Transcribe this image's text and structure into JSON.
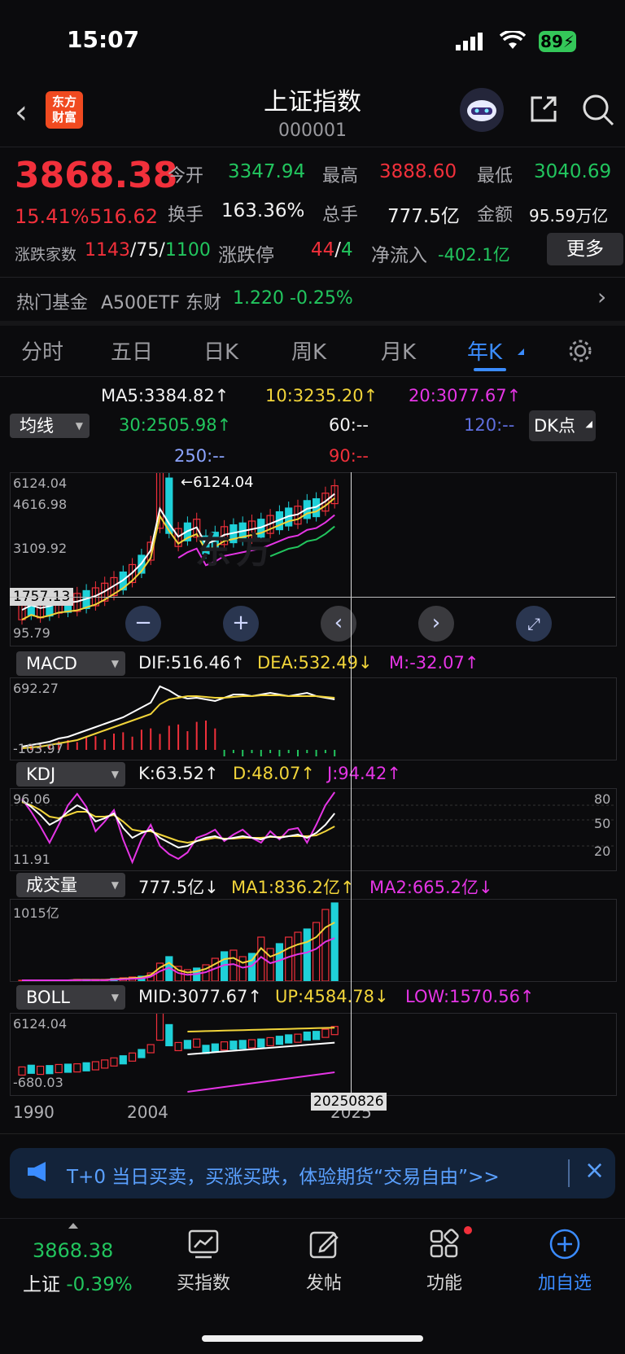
{
  "status_bar": {
    "time": "15:07",
    "battery": "89"
  },
  "header": {
    "logo_text_1": "东方",
    "logo_text_2": "财富",
    "title": "上证指数",
    "code": "000001"
  },
  "quote": {
    "price": "3868.38",
    "change_pct": "15.41%",
    "change_val": "516.62",
    "open_label": "今开",
    "open": "3347.94",
    "high_label": "最高",
    "high": "3888.60",
    "low_label": "最低",
    "low": "3040.69",
    "turnover_label": "换手",
    "turnover": "163.36%",
    "volume_label": "总手",
    "volume": "777.5亿",
    "amount_label": "金额",
    "amount": "95.59万亿",
    "breadth_label": "涨跌家数",
    "up_count": "1143",
    "flat_count": "/75/",
    "down_count": "1100",
    "limit_label": "涨跌停",
    "limit_up": "44",
    "limit_sep": "/",
    "limit_down": "4",
    "netflow_label": "净流入",
    "netflow": "-402.1亿",
    "more_button": "更多"
  },
  "hot_fund": {
    "label": "热门基金",
    "name": "A500ETF 东财",
    "price": "1.220",
    "change": "-0.25%"
  },
  "tabs": [
    "分时",
    "五日",
    "日K",
    "周K",
    "月K",
    "年K"
  ],
  "ma": {
    "selector": "均线",
    "ma5": "MA5:3384.82↑",
    "ma10": "10:3235.20↑",
    "ma20": "20:3077.67↑",
    "ma30": "30:2505.98↑",
    "ma60": "60:--",
    "ma120": "120:--",
    "ma250": "250:--",
    "ma90": "90:--",
    "dk_button": "DK点"
  },
  "kline": {
    "y_top": "6124.04",
    "y2": "4616.98",
    "y3": "3109.92",
    "cross_price": "1757.13",
    "y_low": "95.79",
    "max_marker": "←6124.04"
  },
  "macd": {
    "selector": "MACD",
    "dif": "DIF:516.46↑",
    "dea": "DEA:532.49↓",
    "m": "M:-32.07↑",
    "y_top": "692.27",
    "y_bottom": "-103.97"
  },
  "kdj": {
    "selector": "KDJ",
    "k": "K:63.52↑",
    "d": "D:48.07↑",
    "j": "J:94.42↑",
    "y_top": "96.06",
    "y_bottom": "11.91",
    "lvl80": "80",
    "lvl50": "50",
    "lvl20": "20"
  },
  "volume": {
    "selector": "成交量",
    "vol": "777.5亿↓",
    "ma1": "MA1:836.2亿↑",
    "ma2": "MA2:665.2亿↓",
    "y_top": "1015亿"
  },
  "boll": {
    "selector": "BOLL",
    "mid": "MID:3077.67↑",
    "up": "UP:4584.78↓",
    "low": "LOW:1570.56↑",
    "y_top": "6124.04",
    "y_bottom": "-680.03"
  },
  "x_axis": {
    "left": "1990",
    "mid": "2004",
    "right": "2025",
    "cursor_date": "20250826"
  },
  "banner": {
    "text": "T+0 当日买卖，买涨买跌，体验期货“交易自由”>>"
  },
  "bottom_nav": {
    "index_price": "3868.38",
    "index_name": "上证",
    "index_change": "-0.39%",
    "buy_index": "买指数",
    "post": "发帖",
    "functions": "功能",
    "add_watch": "加自选"
  },
  "colors": {
    "up": "#f1303b",
    "down": "#22c55e",
    "accent": "#3b82f6",
    "bg": "#0b0b0d"
  }
}
